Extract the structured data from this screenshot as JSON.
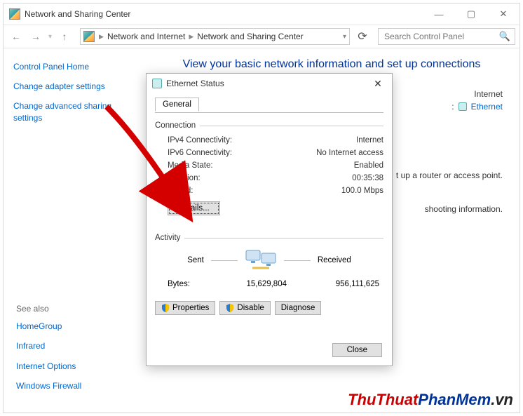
{
  "window": {
    "title": "Network and Sharing Center",
    "breadcrumbs": [
      "Network and Internet",
      "Network and Sharing Center"
    ],
    "search_placeholder": "Search Control Panel"
  },
  "sidebar": {
    "home": "Control Panel Home",
    "links": [
      "Change adapter settings",
      "Change advanced sharing settings"
    ],
    "see_also_head": "See also",
    "see_also": [
      "HomeGroup",
      "Infrared",
      "Internet Options",
      "Windows Firewall"
    ]
  },
  "main": {
    "heading": "View your basic network information and set up connections",
    "internet_label": "Internet",
    "ethernet_link": "Ethernet",
    "line_router": "t up a router or access point.",
    "line_trouble": "shooting information."
  },
  "dialog": {
    "title": "Ethernet Status",
    "tab": "General",
    "connection_group": "Connection",
    "rows": {
      "ipv4_k": "IPv4 Connectivity:",
      "ipv4_v": "Internet",
      "ipv6_k": "IPv6 Connectivity:",
      "ipv6_v": "No Internet access",
      "media_k": "Media State:",
      "media_v": "Enabled",
      "dur_k": "Duration:",
      "dur_v": "00:35:38",
      "speed_k": "Speed:",
      "speed_v": "100.0 Mbps"
    },
    "details_btn": "Details...",
    "activity_group": "Activity",
    "sent_label": "Sent",
    "received_label": "Received",
    "bytes_label": "Bytes:",
    "bytes_sent": "15,629,804",
    "bytes_received": "956,111,625",
    "buttons": {
      "properties": "Properties",
      "disable": "Disable",
      "diagnose": "Diagnose",
      "close": "Close"
    }
  },
  "watermark": {
    "a": "ThuThuat",
    "b": "PhanMem",
    "c": ".vn"
  }
}
